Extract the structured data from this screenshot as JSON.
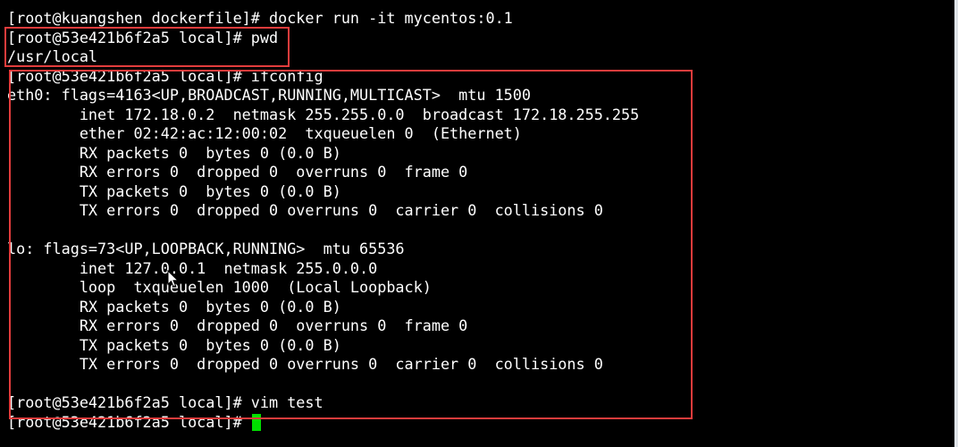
{
  "terminal": {
    "lines": [
      "[root@kuangshen dockerfile]# docker run -it mycentos:0.1",
      "[root@53e421b6f2a5 local]# pwd",
      "/usr/local",
      "[root@53e421b6f2a5 local]# ifconfig",
      "eth0: flags=4163<UP,BROADCAST,RUNNING,MULTICAST>  mtu 1500",
      "        inet 172.18.0.2  netmask 255.255.0.0  broadcast 172.18.255.255",
      "        ether 02:42:ac:12:00:02  txqueuelen 0  (Ethernet)",
      "        RX packets 0  bytes 0 (0.0 B)",
      "        RX errors 0  dropped 0  overruns 0  frame 0",
      "        TX packets 0  bytes 0 (0.0 B)",
      "        TX errors 0  dropped 0 overruns 0  carrier 0  collisions 0",
      "",
      "lo: flags=73<UP,LOOPBACK,RUNNING>  mtu 65536",
      "        inet 127.0.0.1  netmask 255.0.0.0",
      "        loop  txqueuelen 1000  (Local Loopback)",
      "        RX packets 0  bytes 0 (0.0 B)",
      "        RX errors 0  dropped 0  overruns 0  frame 0",
      "        TX packets 0  bytes 0 (0.0 B)",
      "        TX errors 0  dropped 0 overruns 0  carrier 0  collisions 0",
      "",
      "[root@53e421b6f2a5 local]# vim test",
      "[root@53e421b6f2a5 local]# "
    ]
  },
  "colors": {
    "background": "#000000",
    "text": "#ffffff",
    "cursor": "#00e000",
    "annotation_border": "#e23c3c"
  },
  "icons": {
    "cursor": "text-cursor-block",
    "pointer": "mouse-pointer-icon"
  }
}
